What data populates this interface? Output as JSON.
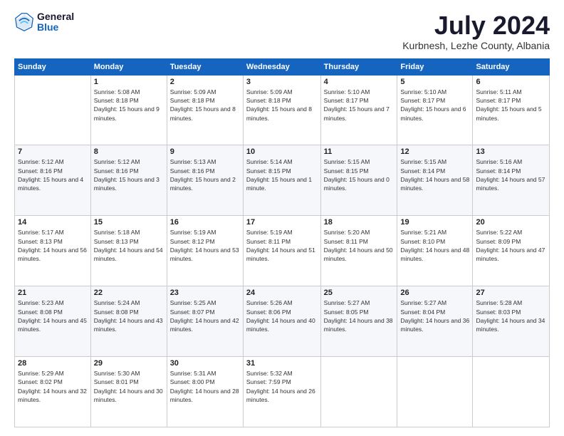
{
  "logo": {
    "general": "General",
    "blue": "Blue"
  },
  "title": "July 2024",
  "subtitle": "Kurbnesh, Lezhe County, Albania",
  "days": [
    "Sunday",
    "Monday",
    "Tuesday",
    "Wednesday",
    "Thursday",
    "Friday",
    "Saturday"
  ],
  "weeks": [
    [
      {
        "date": "",
        "sunrise": "",
        "sunset": "",
        "daylight": ""
      },
      {
        "date": "1",
        "sunrise": "Sunrise: 5:08 AM",
        "sunset": "Sunset: 8:18 PM",
        "daylight": "Daylight: 15 hours and 9 minutes."
      },
      {
        "date": "2",
        "sunrise": "Sunrise: 5:09 AM",
        "sunset": "Sunset: 8:18 PM",
        "daylight": "Daylight: 15 hours and 8 minutes."
      },
      {
        "date": "3",
        "sunrise": "Sunrise: 5:09 AM",
        "sunset": "Sunset: 8:18 PM",
        "daylight": "Daylight: 15 hours and 8 minutes."
      },
      {
        "date": "4",
        "sunrise": "Sunrise: 5:10 AM",
        "sunset": "Sunset: 8:17 PM",
        "daylight": "Daylight: 15 hours and 7 minutes."
      },
      {
        "date": "5",
        "sunrise": "Sunrise: 5:10 AM",
        "sunset": "Sunset: 8:17 PM",
        "daylight": "Daylight: 15 hours and 6 minutes."
      },
      {
        "date": "6",
        "sunrise": "Sunrise: 5:11 AM",
        "sunset": "Sunset: 8:17 PM",
        "daylight": "Daylight: 15 hours and 5 minutes."
      }
    ],
    [
      {
        "date": "7",
        "sunrise": "Sunrise: 5:12 AM",
        "sunset": "Sunset: 8:16 PM",
        "daylight": "Daylight: 15 hours and 4 minutes."
      },
      {
        "date": "8",
        "sunrise": "Sunrise: 5:12 AM",
        "sunset": "Sunset: 8:16 PM",
        "daylight": "Daylight: 15 hours and 3 minutes."
      },
      {
        "date": "9",
        "sunrise": "Sunrise: 5:13 AM",
        "sunset": "Sunset: 8:16 PM",
        "daylight": "Daylight: 15 hours and 2 minutes."
      },
      {
        "date": "10",
        "sunrise": "Sunrise: 5:14 AM",
        "sunset": "Sunset: 8:15 PM",
        "daylight": "Daylight: 15 hours and 1 minute."
      },
      {
        "date": "11",
        "sunrise": "Sunrise: 5:15 AM",
        "sunset": "Sunset: 8:15 PM",
        "daylight": "Daylight: 15 hours and 0 minutes."
      },
      {
        "date": "12",
        "sunrise": "Sunrise: 5:15 AM",
        "sunset": "Sunset: 8:14 PM",
        "daylight": "Daylight: 14 hours and 58 minutes."
      },
      {
        "date": "13",
        "sunrise": "Sunrise: 5:16 AM",
        "sunset": "Sunset: 8:14 PM",
        "daylight": "Daylight: 14 hours and 57 minutes."
      }
    ],
    [
      {
        "date": "14",
        "sunrise": "Sunrise: 5:17 AM",
        "sunset": "Sunset: 8:13 PM",
        "daylight": "Daylight: 14 hours and 56 minutes."
      },
      {
        "date": "15",
        "sunrise": "Sunrise: 5:18 AM",
        "sunset": "Sunset: 8:13 PM",
        "daylight": "Daylight: 14 hours and 54 minutes."
      },
      {
        "date": "16",
        "sunrise": "Sunrise: 5:19 AM",
        "sunset": "Sunset: 8:12 PM",
        "daylight": "Daylight: 14 hours and 53 minutes."
      },
      {
        "date": "17",
        "sunrise": "Sunrise: 5:19 AM",
        "sunset": "Sunset: 8:11 PM",
        "daylight": "Daylight: 14 hours and 51 minutes."
      },
      {
        "date": "18",
        "sunrise": "Sunrise: 5:20 AM",
        "sunset": "Sunset: 8:11 PM",
        "daylight": "Daylight: 14 hours and 50 minutes."
      },
      {
        "date": "19",
        "sunrise": "Sunrise: 5:21 AM",
        "sunset": "Sunset: 8:10 PM",
        "daylight": "Daylight: 14 hours and 48 minutes."
      },
      {
        "date": "20",
        "sunrise": "Sunrise: 5:22 AM",
        "sunset": "Sunset: 8:09 PM",
        "daylight": "Daylight: 14 hours and 47 minutes."
      }
    ],
    [
      {
        "date": "21",
        "sunrise": "Sunrise: 5:23 AM",
        "sunset": "Sunset: 8:08 PM",
        "daylight": "Daylight: 14 hours and 45 minutes."
      },
      {
        "date": "22",
        "sunrise": "Sunrise: 5:24 AM",
        "sunset": "Sunset: 8:08 PM",
        "daylight": "Daylight: 14 hours and 43 minutes."
      },
      {
        "date": "23",
        "sunrise": "Sunrise: 5:25 AM",
        "sunset": "Sunset: 8:07 PM",
        "daylight": "Daylight: 14 hours and 42 minutes."
      },
      {
        "date": "24",
        "sunrise": "Sunrise: 5:26 AM",
        "sunset": "Sunset: 8:06 PM",
        "daylight": "Daylight: 14 hours and 40 minutes."
      },
      {
        "date": "25",
        "sunrise": "Sunrise: 5:27 AM",
        "sunset": "Sunset: 8:05 PM",
        "daylight": "Daylight: 14 hours and 38 minutes."
      },
      {
        "date": "26",
        "sunrise": "Sunrise: 5:27 AM",
        "sunset": "Sunset: 8:04 PM",
        "daylight": "Daylight: 14 hours and 36 minutes."
      },
      {
        "date": "27",
        "sunrise": "Sunrise: 5:28 AM",
        "sunset": "Sunset: 8:03 PM",
        "daylight": "Daylight: 14 hours and 34 minutes."
      }
    ],
    [
      {
        "date": "28",
        "sunrise": "Sunrise: 5:29 AM",
        "sunset": "Sunset: 8:02 PM",
        "daylight": "Daylight: 14 hours and 32 minutes."
      },
      {
        "date": "29",
        "sunrise": "Sunrise: 5:30 AM",
        "sunset": "Sunset: 8:01 PM",
        "daylight": "Daylight: 14 hours and 30 minutes."
      },
      {
        "date": "30",
        "sunrise": "Sunrise: 5:31 AM",
        "sunset": "Sunset: 8:00 PM",
        "daylight": "Daylight: 14 hours and 28 minutes."
      },
      {
        "date": "31",
        "sunrise": "Sunrise: 5:32 AM",
        "sunset": "Sunset: 7:59 PM",
        "daylight": "Daylight: 14 hours and 26 minutes."
      },
      {
        "date": "",
        "sunrise": "",
        "sunset": "",
        "daylight": ""
      },
      {
        "date": "",
        "sunrise": "",
        "sunset": "",
        "daylight": ""
      },
      {
        "date": "",
        "sunrise": "",
        "sunset": "",
        "daylight": ""
      }
    ]
  ]
}
